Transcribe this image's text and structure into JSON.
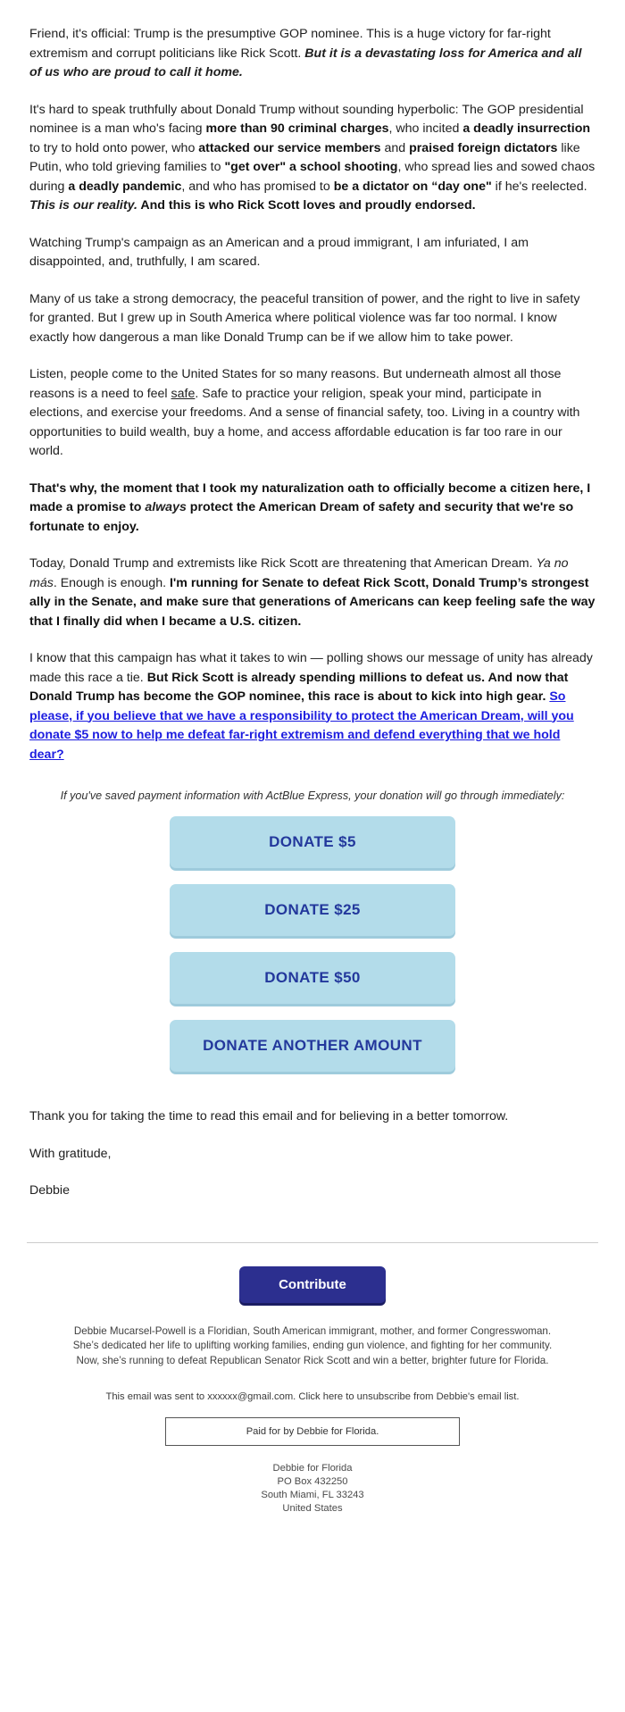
{
  "email": {
    "paragraphs": [
      {
        "id": "p1",
        "segments": [
          {
            "text": "Friend, it's official: Trump is the presumptive GOP nominee. This is a huge victory for far-right extremism and corrupt politicians like Rick Scott. ",
            "style": "normal"
          },
          {
            "text": "But it is a devastating loss for America and all of us who are proud to call it home.",
            "style": "bold-italic"
          }
        ]
      },
      {
        "id": "p2",
        "segments": [
          {
            "text": "It's hard to speak truthfully about Donald Trump without sounding hyperbolic: The GOP presidential nominee is a man who's facing ",
            "style": "normal"
          },
          {
            "text": "more than 90 criminal charges",
            "style": "bold"
          },
          {
            "text": ", who incited ",
            "style": "normal"
          },
          {
            "text": "a deadly insurrection",
            "style": "bold"
          },
          {
            "text": " to try to hold onto power, who ",
            "style": "normal"
          },
          {
            "text": "attacked our service members",
            "style": "bold"
          },
          {
            "text": " and ",
            "style": "normal"
          },
          {
            "text": "praised foreign dictators",
            "style": "bold"
          },
          {
            "text": " like Putin, who told grieving families to ",
            "style": "normal"
          },
          {
            "text": "\"get over\" a school shooting",
            "style": "bold"
          },
          {
            "text": ", who spread lies and sowed chaos during ",
            "style": "normal"
          },
          {
            "text": "a deadly pandemic",
            "style": "bold"
          },
          {
            "text": ", and who has promised to ",
            "style": "normal"
          },
          {
            "text": "be a dictator on “day one\"",
            "style": "bold"
          },
          {
            "text": " if he's reelected. ",
            "style": "normal"
          },
          {
            "text": "This is our reality.",
            "style": "bold-italic"
          },
          {
            "text": " And this is who Rick Scott loves and proudly endorsed.",
            "style": "bold"
          }
        ]
      },
      {
        "id": "p3",
        "segments": [
          {
            "text": "Watching Trump's campaign as an American and a proud immigrant, I am infuriated, I am disappointed, and, truthfully, I am scared.",
            "style": "normal"
          }
        ]
      },
      {
        "id": "p4",
        "segments": [
          {
            "text": "Many of us take a strong democracy, the peaceful transition of power, and the right to live in safety for granted. But I grew up in South America where political violence was far too normal. I know exactly how dangerous a man like Donald Trump can be if we allow him to take power.",
            "style": "normal"
          }
        ]
      },
      {
        "id": "p5",
        "segments": [
          {
            "text": "Listen, people come to the United States for so many reasons. But underneath almost all those reasons is a need to feel ",
            "style": "normal"
          },
          {
            "text": "safe",
            "style": "underline"
          },
          {
            "text": ". Safe to practice your religion, speak your mind, participate in elections, and exercise your freedoms. And a sense of financial safety, too. Living in a country with opportunities to build wealth, buy a home, and access affordable education is far too rare in our world.",
            "style": "normal"
          }
        ]
      },
      {
        "id": "p6",
        "segments": [
          {
            "text": "That's why, the moment that I took my naturalization oath to officially become a citizen here, I made a promise to ",
            "style": "bold"
          },
          {
            "text": "always",
            "style": "bold-italic"
          },
          {
            "text": " protect the American Dream of safety and security that we're so fortunate to enjoy.",
            "style": "bold"
          }
        ]
      },
      {
        "id": "p7",
        "segments": [
          {
            "text": "Today, Donald Trump and extremists like Rick Scott are threatening that American Dream. ",
            "style": "normal"
          },
          {
            "text": "Ya no más",
            "style": "italic"
          },
          {
            "text": ". Enough is enough. ",
            "style": "normal"
          },
          {
            "text": "I'm running for Senate to defeat Rick Scott, Donald Trump’s strongest ally in the Senate, and make sure that generations of Americans can keep feeling safe the way that I finally did when I became a U.S. citizen.",
            "style": "bold"
          }
        ]
      },
      {
        "id": "p8",
        "segments": [
          {
            "text": "I know that this campaign has what it takes to win — polling shows our message of unity has already made this race a tie. ",
            "style": "normal"
          },
          {
            "text": "But Rick Scott is already spending millions to defeat us. And now that Donald Trump has become the GOP nominee, this race is about to kick into high gear. ",
            "style": "bold"
          },
          {
            "text": "So please, if you believe that we have a responsibility to protect the American Dream, will you donate $5 now to help me defeat far-right extremism and defend everything that we hold dear?",
            "style": "link"
          }
        ]
      }
    ],
    "express_note": "If you've saved payment information with ActBlue Express, your donation will go through immediately:",
    "donate_buttons": [
      {
        "label": "DONATE $5"
      },
      {
        "label": "DONATE $25"
      },
      {
        "label": "DONATE $50"
      },
      {
        "label": "DONATE ANOTHER AMOUNT"
      }
    ],
    "closing_paragraphs": [
      {
        "id": "c1",
        "segments": [
          {
            "text": "Thank you for taking the time to read this email and for believing in a better tomorrow.",
            "style": "normal"
          }
        ]
      },
      {
        "id": "c2",
        "segments": [
          {
            "text": "With gratitude,",
            "style": "normal"
          }
        ]
      },
      {
        "id": "c3",
        "segments": [
          {
            "text": "Debbie",
            "style": "normal"
          }
        ]
      }
    ]
  },
  "footer": {
    "contribute_label": "Contribute",
    "bio": "Debbie Mucarsel-Powell is a Floridian, South American immigrant, mother, and former Congresswoman. She’s dedicated her life to uplifting working families, ending gun violence, and fighting for her community. Now, she’s running to defeat Republican Senator Rick Scott and win a better, brighter future for Florida.",
    "sent_to_line": "This email was sent to xxxxxx@gmail.com. Click here to unsubscribe from Debbie's email list.",
    "paid_for": "Paid for by Debbie for Florida.",
    "address_lines": [
      "Debbie for Florida",
      "PO Box 432250",
      "South Miami, FL 33243",
      "United States"
    ]
  },
  "colors": {
    "link_blue": "#1d1de0",
    "donate_button_bg": "#b3dcea",
    "donate_button_text": "#23389c",
    "contribute_bg": "#2c2f8f",
    "body_text": "#202020"
  }
}
